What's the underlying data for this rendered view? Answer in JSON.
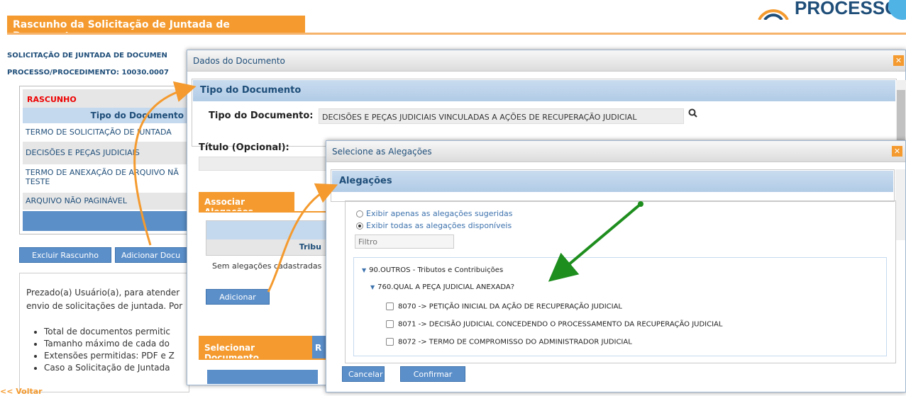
{
  "page": {
    "tab_title": "Rascunho da Solicitação de Juntada de Documentos",
    "solicitacao_label": "SOLICITAÇÃO DE JUNTADA DE DOCUMEN",
    "processo_label": "PROCESSO/PROCEDIMENTO: 10030.0007",
    "rascunho": {
      "title": "RASCUNHO",
      "col_header": "Tipo do Documento",
      "rows": [
        "TERMO DE SOLICITAÇÃO DE JUNTADA",
        "DECISÕES E PEÇAS JUDICIAIS",
        "TERMO DE ANEXAÇÃO DE ARQUIVO NÃ TESTE",
        "ARQUIVO NÃO PAGINÁVEL"
      ]
    },
    "excluir_button": "Excluir Rascunho",
    "adicionar_button": "Adicionar Docu",
    "info_text": "Prezado(a) Usuário(a), para atender envio de solicitações de juntada. Por",
    "info_list": [
      "Total de documentos permitic",
      "Tamanho máximo de cada do",
      "Extensões permitidas: PDF e Z",
      "Caso a Solicitação de Juntada"
    ],
    "voltar": "<< Voltar"
  },
  "modal_documento": {
    "title": "Dados do Documento",
    "section_tipo": "Tipo do Documento",
    "tipo_label": "Tipo do Documento:",
    "tipo_value": "DECISÕES E PEÇAS JUDICIAIS VINCULADAS A AÇÕES DE RECUPERAÇÃO JUDICIAL",
    "titulo_label": "Título (Opcional):",
    "associar_tab": "Associar Alegações",
    "tribu_header": "Tribu",
    "sem_alegacoes": "Sem alegações cadastradas",
    "adicionar_button": "Adicionar",
    "selecionar_tab": "Selecionar Documento",
    "next_tab": "R"
  },
  "modal_alegacoes": {
    "title": "Selecione as Alegações",
    "section": "Alegações",
    "radio_sugeridas": "Exibir apenas as alegações sugeridas",
    "radio_todas": "Exibir todas as alegações disponíveis",
    "filter_placeholder": "Filtro",
    "tree": {
      "root": "90.OUTROS - Tributos e Contribuições",
      "child": "760.QUAL A PEÇA JUDICIAL ANEXADA?",
      "items": [
        "8070 -> PETIÇÃO INICIAL DA AÇÃO DE RECUPERAÇÃO JUDICIAL",
        "8071 -> DECISÃO JUDICIAL CONCEDENDO O PROCESSAMENTO DA RECUPERAÇÃO JUDICIAL",
        "8072 -> TERMO DE COMPROMISSO DO ADMINISTRADOR JUDICIAL"
      ]
    },
    "cancel_button": "Cancelar",
    "confirm_button": "Confirmar"
  },
  "colors": {
    "accent": "#f49a2e",
    "primary": "#5b8fca",
    "arrow_orange": "#f49a2e",
    "arrow_green": "#1e8e1e"
  }
}
